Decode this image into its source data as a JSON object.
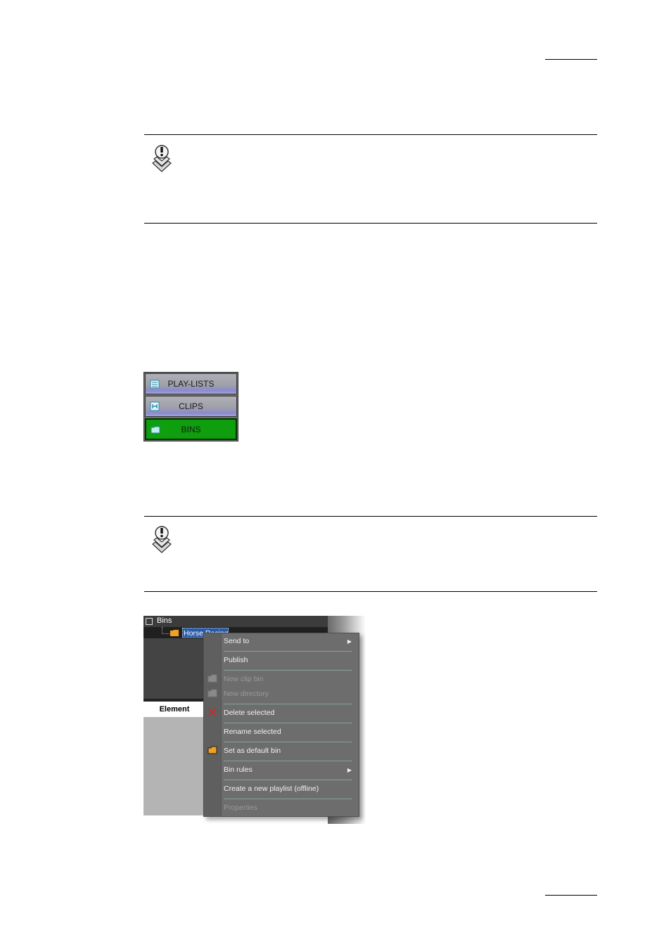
{
  "panel": {
    "playlists_label": "PLAY-LISTS",
    "clips_label": "CLIPS",
    "bins_label": "BINS"
  },
  "screenshot": {
    "tree_root": "Bins",
    "tree_item": "Horse Racing",
    "element_header": "Element",
    "menu_items": [
      {
        "label": "Send to",
        "submenu": true,
        "disabled": false
      },
      {
        "label": "Publish",
        "submenu": false,
        "disabled": false
      },
      {
        "label": "New clip bin",
        "submenu": false,
        "disabled": true
      },
      {
        "label": "New directory",
        "submenu": false,
        "disabled": true
      },
      {
        "label": "Delete selected",
        "submenu": false,
        "disabled": false
      },
      {
        "label": "Rename selected",
        "submenu": false,
        "disabled": false
      },
      {
        "label": "Set as default bin",
        "submenu": false,
        "disabled": false
      },
      {
        "label": "Bin rules",
        "submenu": true,
        "disabled": false
      },
      {
        "label": "Create a new playlist (offline)",
        "submenu": false,
        "disabled": false
      },
      {
        "label": "Properties",
        "submenu": false,
        "disabled": true
      }
    ]
  },
  "colors": {
    "bins_active": "#0e9e0e",
    "menu_bg": "#6d6d6d"
  }
}
